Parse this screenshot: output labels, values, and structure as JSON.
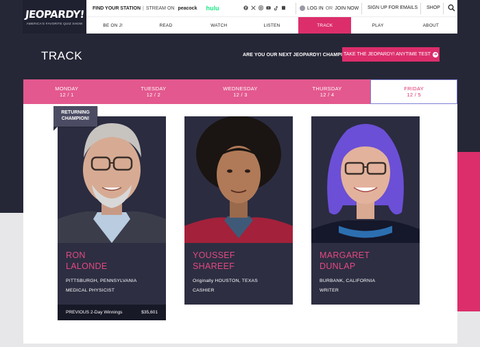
{
  "header": {
    "logo_wordmark": "JEOPARDY!",
    "logo_tagline": "AMERICA'S FAVORITE QUIZ SHOW",
    "find_station": "FIND YOUR STATION",
    "divider": "|",
    "stream_on": "STREAM ON",
    "peacock": "peacock",
    "hulu": "hulu",
    "social_icons": [
      "facebook-icon",
      "x-icon",
      "instagram-icon",
      "youtube-icon",
      "tiktok-icon",
      "store-icon"
    ],
    "login": "LOG IN",
    "or": "OR",
    "join": "JOIN NOW",
    "signup": "SIGN UP FOR EMAILS",
    "shop": "SHOP"
  },
  "nav": {
    "items": [
      "BE ON J!",
      "READ",
      "WATCH",
      "LISTEN",
      "TRACK",
      "PLAY",
      "ABOUT"
    ],
    "active": "TRACK"
  },
  "page": {
    "title": "TRACK",
    "promo_text": "ARE YOU OUR NEXT JEOPARDY! CHAMPION?",
    "promo_button": "TAKE THE JEOPARDY! ANYTIME TEST"
  },
  "days": [
    {
      "day": "MONDAY",
      "date": "12 / 1"
    },
    {
      "day": "TUESDAY",
      "date": "12 / 2"
    },
    {
      "day": "WEDNESDAY",
      "date": "12 / 3"
    },
    {
      "day": "THURSDAY",
      "date": "12 / 4"
    },
    {
      "day": "FRIDAY",
      "date": "12 / 5"
    }
  ],
  "active_day": "FRIDAY",
  "returning_badge": {
    "line1": "RETURNING",
    "line2": "CHAMPION!"
  },
  "contestants": [
    {
      "first": "RON",
      "last": "LALONDE",
      "location": "PITTSBURGH, PENNSYLVANIA",
      "job": "MEDICAL PHYSICIST",
      "winnings_label": "PREVIOUS 2-Day Winnings",
      "winnings_value": "$35,601"
    },
    {
      "first": "YOUSSEF",
      "last": "SHAREEF",
      "location": "Originally HOUSTON, TEXAS",
      "job": "CASHIER"
    },
    {
      "first": "MARGARET",
      "last": "DUNLAP",
      "location": "BURBANK, CALIFORNIA",
      "job": "WRITER"
    }
  ],
  "colors": {
    "brand_pink": "#dc2e6b",
    "tab_pink": "#e3588e",
    "navy": "#262736",
    "card": "#2d2e42",
    "hulu_green": "#1ce783"
  }
}
